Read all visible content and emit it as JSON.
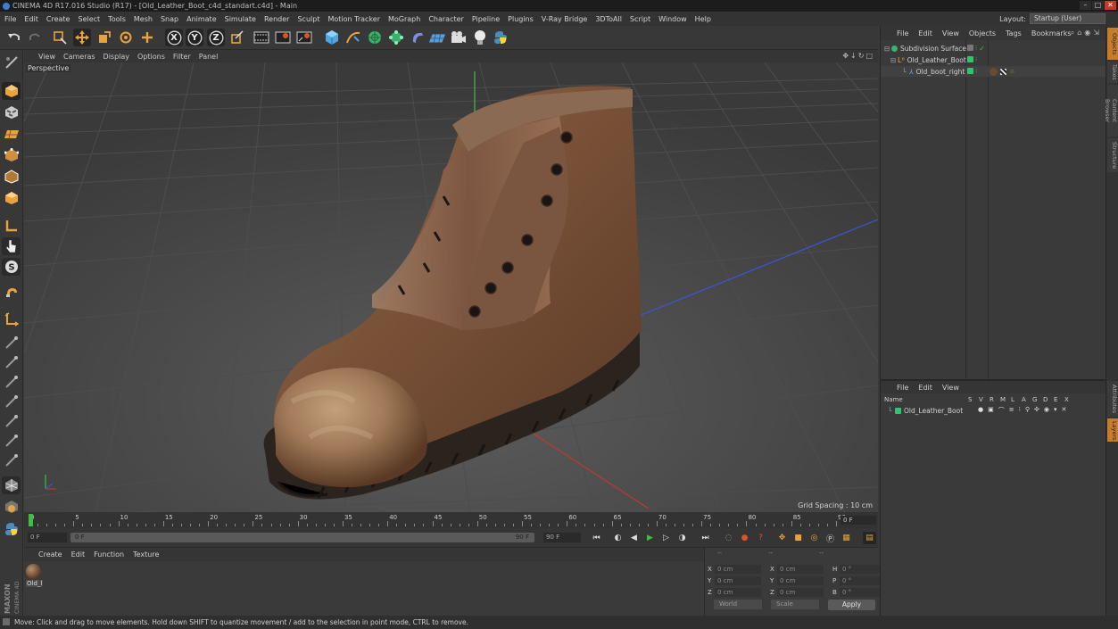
{
  "window": {
    "title": "CINEMA 4D R17.016 Studio (R17) - [Old_Leather_Boot_c4d_standart.c4d] - Main",
    "controls": [
      "–",
      "□",
      "✕"
    ]
  },
  "menubar": {
    "items": [
      "File",
      "Edit",
      "Create",
      "Select",
      "Tools",
      "Mesh",
      "Snap",
      "Animate",
      "Simulate",
      "Render",
      "Sculpt",
      "Motion Tracker",
      "MoGraph",
      "Character",
      "Pipeline",
      "Plugins",
      "V-Ray Bridge",
      "3DToAll",
      "Script",
      "Window",
      "Help"
    ],
    "layout_label": "Layout:",
    "layout_value": "Startup (User)"
  },
  "toolbar": {
    "axis_x": "X",
    "axis_y": "Y",
    "axis_z": "Z"
  },
  "viewport": {
    "menu": [
      "View",
      "Cameras",
      "Display",
      "Options",
      "Filter",
      "Panel"
    ],
    "camera_label": "Perspective",
    "grid_spacing": "Grid Spacing : 10 cm",
    "nav_icons": "✥↓↻□"
  },
  "timeline": {
    "ticks": [
      "0",
      "5",
      "10",
      "15",
      "20",
      "25",
      "30",
      "35",
      "40",
      "45",
      "50",
      "55",
      "60",
      "65",
      "70",
      "75",
      "80",
      "85",
      "90"
    ],
    "current_frame": "0 F"
  },
  "playback": {
    "start_field": "0 F",
    "min_field": "0 F",
    "max_field": "90 F",
    "end_field": "90 F"
  },
  "materials": {
    "menu": [
      "Create",
      "Edit",
      "Function",
      "Texture"
    ],
    "items": [
      {
        "label": "Old_l"
      }
    ]
  },
  "coordinates": {
    "header": [
      "--",
      "--",
      "--"
    ],
    "rows": [
      {
        "a": "X",
        "a_val": "0 cm",
        "b": "X",
        "b_val": "0 cm",
        "c": "H",
        "c_val": "0 °"
      },
      {
        "a": "Y",
        "a_val": "0 cm",
        "b": "Y",
        "b_val": "0 cm",
        "c": "P",
        "c_val": "0 °"
      },
      {
        "a": "Z",
        "a_val": "0 cm",
        "b": "Z",
        "b_val": "0 cm",
        "c": "B",
        "c_val": "0 °"
      }
    ],
    "mode": "World",
    "transform": "Scale",
    "apply": "Apply"
  },
  "object_manager": {
    "menu": [
      "File",
      "Edit",
      "View",
      "Objects",
      "Tags",
      "Bookmarks"
    ],
    "objects": [
      {
        "name": "Subdivision Surface",
        "indent": 0
      },
      {
        "name": "Old_Leather_Boot",
        "indent": 1
      },
      {
        "name": "Old_boot_right",
        "indent": 2
      }
    ]
  },
  "attribute_manager": {
    "menu": [
      "File",
      "Edit",
      "View"
    ],
    "columns": [
      "Name",
      "S",
      "V",
      "R",
      "M",
      "L",
      "A",
      "G",
      "D",
      "E",
      "X"
    ],
    "rows": [
      {
        "name": "Old_Leather_Boot"
      }
    ]
  },
  "right_tabs": [
    "Objects",
    "Takes",
    "Content Browser",
    "Structure",
    "Attributes",
    "Layers"
  ],
  "statusbar": {
    "text": "Move: Click and drag to move elements. Hold down SHIFT to quantize movement / add to the selection in point mode, CTRL to remove."
  },
  "branding": {
    "logo": "MAXON CINEMA 4D"
  },
  "colors": {
    "accent_orange": "#e8a33d",
    "object_green": "#2fc46d",
    "axis_x_red": "#c0392b",
    "axis_y_green": "#3fbf3f",
    "axis_z_blue": "#3a55d8"
  }
}
